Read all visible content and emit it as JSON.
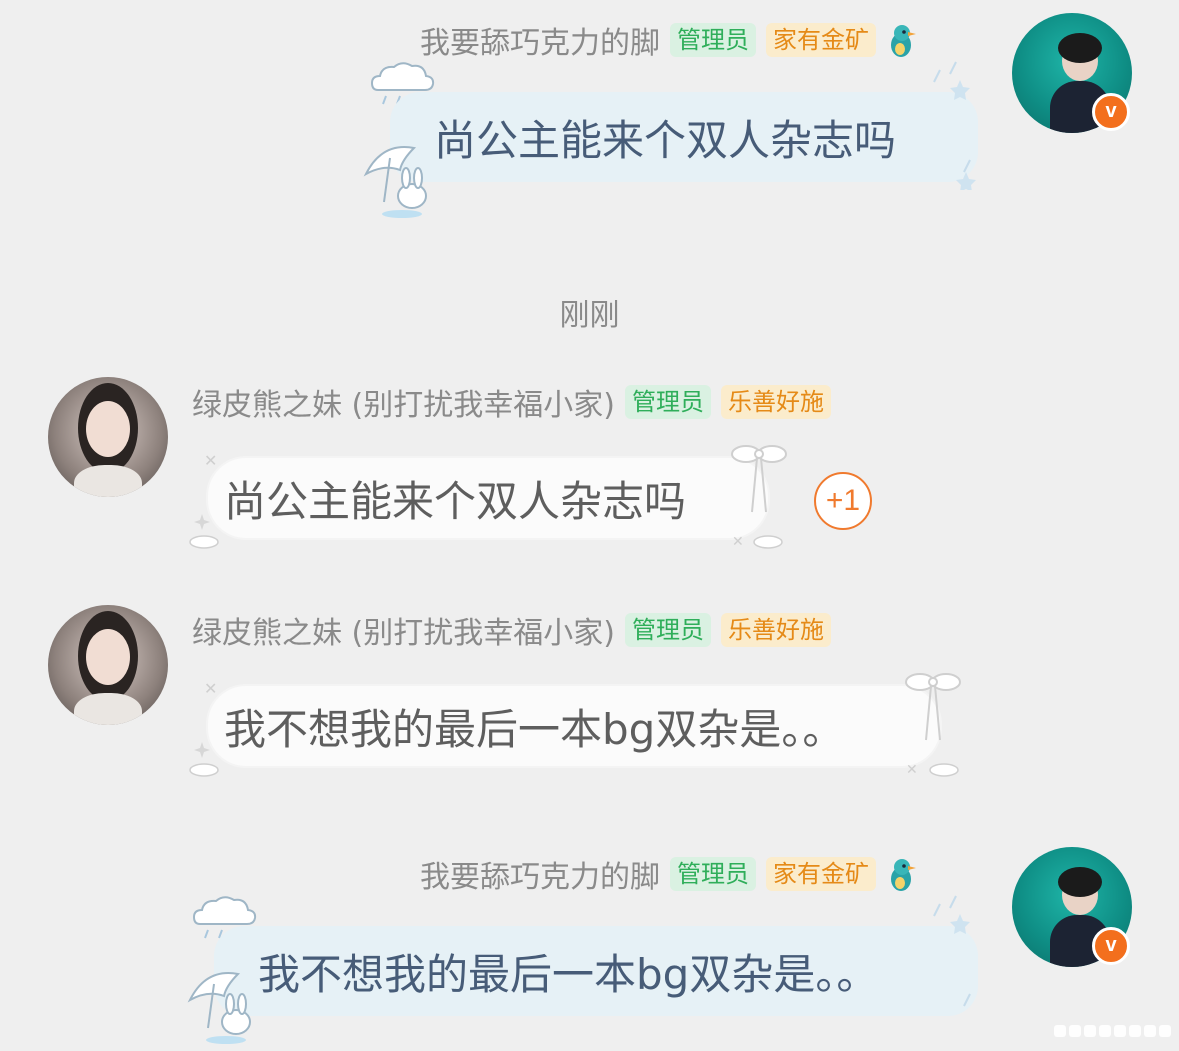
{
  "messages": [
    {
      "side": "right",
      "user": "我要舔巧克力的脚",
      "tags": [
        "管理员",
        "家有金矿"
      ],
      "text": "尚公主能来个双人杂志吗"
    },
    {
      "side": "left",
      "user": "绿皮熊之妹 (别打扰我幸福小家)",
      "tags": [
        "管理员",
        "乐善好施"
      ],
      "text": "尚公主能来个双人杂志吗",
      "plus_one": "+1"
    },
    {
      "side": "left",
      "user": "绿皮熊之妹 (别打扰我幸福小家)",
      "tags": [
        "管理员",
        "乐善好施"
      ],
      "text": "我不想我的最后一本bg双杂是。。"
    },
    {
      "side": "right",
      "user": "我要舔巧克力的脚",
      "tags": [
        "管理员",
        "家有金矿"
      ],
      "text": "我不想我的最后一本bg双杂是。。"
    }
  ],
  "timestamp": "刚刚",
  "badge_letter": "v",
  "colors": {
    "background": "#efefef",
    "admin_tag": "#2fae5a",
    "gold_tag": "#e58a17",
    "vip_badge": "#f36f1d"
  },
  "icons": [
    "kingfisher-icon",
    "cloud-rain-icon",
    "umbrella-bunny-icon",
    "bow-ribbon-icon",
    "sparkle-icon"
  ]
}
